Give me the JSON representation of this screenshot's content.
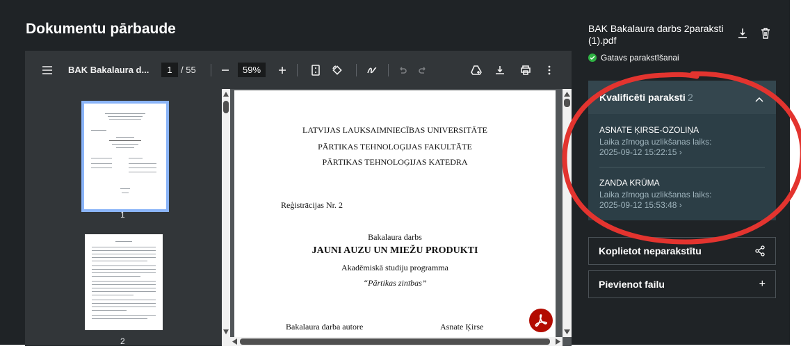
{
  "app": {
    "title": "Dokumentu pārbaude"
  },
  "viewer": {
    "doc_title": "BAK Bakalaura d...",
    "page_current": "1",
    "page_total": "/ 55",
    "zoom": "59%",
    "thumbnails": [
      {
        "number": "1"
      },
      {
        "number": "2"
      }
    ],
    "page": {
      "line1": "LATVIJAS LAUKSAIMNIECĪBAS UNIVERSITĀTE",
      "line2": "PĀRTIKAS TEHNOLOĢIJAS FAKULTĀTE",
      "line3": "PĀRTIKAS TEHNOLOĢIJAS KATEDRA",
      "registration": "Reģistrācijas Nr. 2",
      "work_type": "Bakalaura darbs",
      "work_title": "JAUNI AUZU UN MIEŽU PRODUKTI",
      "program": "Akadēmiskā studiju programma",
      "program_name": "“Pārtikas zinības”",
      "author_label": "Bakalaura darba autore",
      "author_name": "Asnate Ķirse"
    }
  },
  "file": {
    "name": "BAK Bakalaura darbs 2paraksti (1).pdf",
    "status": "Gatavs parakstīšanai"
  },
  "signatures": {
    "header": "Kvalificēti paraksti",
    "count": "2",
    "items": [
      {
        "name": "ASNATE ĶIRSE-OZOLIŅA",
        "label": "Laika zīmoga uzlikšanas laiks:",
        "time": "2025-09-12 15:22:15 ›"
      },
      {
        "name": "ZANDA KRŪMA",
        "label": "Laika zīmoga uzlikšanas laiks:",
        "time": "2025-09-12 15:53:48 ›"
      }
    ]
  },
  "actions": {
    "share_label": "Koplietot neparakstītu",
    "add_file_label": "Pievienot failu",
    "add_file_symbol": "+"
  },
  "colors": {
    "status_green": "#2fb344",
    "annotation_red": "#e3342f",
    "panel": "#2c3e46"
  }
}
